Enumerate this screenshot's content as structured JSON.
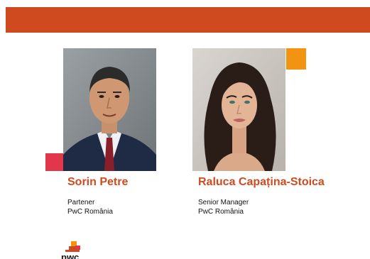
{
  "colors": {
    "brand_orange": "#d04a1f",
    "accent_pink": "#e2364a",
    "accent_amber": "#f29412"
  },
  "people": [
    {
      "name": "Sorin Petre",
      "role": "Partener",
      "company": "PwC România",
      "photo_icon": "man-portrait-photo"
    },
    {
      "name": "Raluca Capațina-Stoica",
      "role": "Senior Manager",
      "company": "PwC România",
      "photo_icon": "woman-portrait-photo"
    }
  ],
  "logo": {
    "icon": "pwc-logo",
    "text": "pwc"
  }
}
